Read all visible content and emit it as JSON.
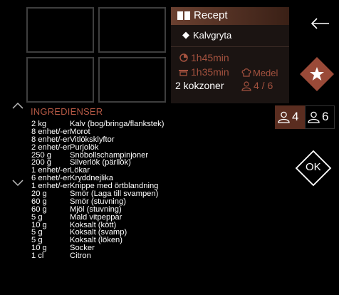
{
  "recipe_label": "Recept",
  "dish_name": "Kalvgryta",
  "prep_time": "1h45min",
  "cook_time": "1h35min",
  "difficulty": "Medel",
  "zones": "2 kokzoner",
  "persons": "4 / 6",
  "servings": {
    "left": "4",
    "right": "6"
  },
  "ok_label": "OK",
  "ingredients_title": "INGREDIENSER",
  "ingredients": [
    {
      "amount": "2 kg",
      "name": "Kalv (bog/bringa/flankstek)"
    },
    {
      "amount": "8 enhet/-er",
      "name": "Morot"
    },
    {
      "amount": "8 enhet/-er",
      "name": "Vitlöksklyftor"
    },
    {
      "amount": "2 enhet/-er",
      "name": "Purjolök"
    },
    {
      "amount": "250 g",
      "name": "Snöbollschampinjoner"
    },
    {
      "amount": "200 g",
      "name": "Silverlök (pärllök)"
    },
    {
      "amount": "1 enhet/-er",
      "name": "Lökar"
    },
    {
      "amount": "6 enhet/-er",
      "name": "Kryddnejlika"
    },
    {
      "amount": "1 enhet/-er",
      "name": "Knippe med örtblandning"
    },
    {
      "amount": "20 g",
      "name": "Smör (Laga till svampen)"
    },
    {
      "amount": "60 g",
      "name": "Smör (stuvning)"
    },
    {
      "amount": "60 g",
      "name": "Mjöl (stuvning)"
    },
    {
      "amount": "5 g",
      "name": "Mald vitpeppar"
    },
    {
      "amount": "10 g",
      "name": "Koksalt (kött)"
    },
    {
      "amount": "5 g",
      "name": "Koksalt (svamp)"
    },
    {
      "amount": "5 g",
      "name": "Koksalt (löken)"
    },
    {
      "amount": "10 g",
      "name": "Socker"
    },
    {
      "amount": "1 cl",
      "name": "Citron"
    }
  ],
  "colors": {
    "accent": "#a4523f",
    "title": "#b45844",
    "button": "#9a4a38"
  }
}
